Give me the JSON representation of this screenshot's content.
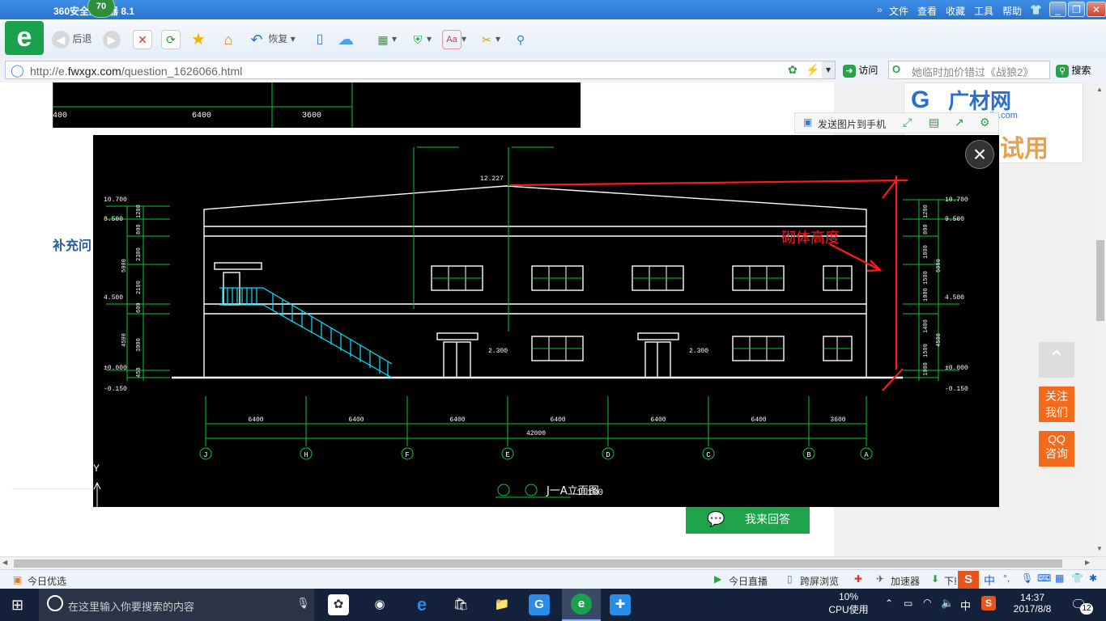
{
  "browser": {
    "title": "360安全浏览器 8.1",
    "badge": "70",
    "menu": [
      "文件",
      "查看",
      "收藏",
      "工具",
      "帮助"
    ],
    "window_buttons": {
      "minimize": "_",
      "maximize": "❐",
      "close": "✕"
    }
  },
  "toolbar": {
    "back_label": "后退",
    "restore_label": "恢复"
  },
  "address_bar": {
    "url_prefix": "http://e.",
    "url_domain": "fwxgx.com",
    "url_path": "/question_1626066.html",
    "visit_label": "访问",
    "search_placeholder": "她临时加价错过《战狼2》",
    "search_label": "搜索"
  },
  "page": {
    "partial_label": "补充问",
    "ad_brand": "广材网",
    "ad_domain": "djc.com",
    "ad_trial": "试用",
    "answer_button": "我来回答",
    "image_toolbar": {
      "send_to_phone": "发送图片到手机"
    },
    "side_buttons": {
      "follow": [
        "关注",
        "我们"
      ],
      "qq": [
        "QQ",
        "咨询"
      ]
    },
    "top_drawing_dims": [
      "400",
      "6400",
      "3600"
    ]
  },
  "drawing": {
    "ridge_elev": "12.227",
    "left_elevs": [
      "10.700",
      "8.500",
      "4.500",
      "±0.000",
      "-0.150"
    ],
    "right_elevs": [
      "10.700",
      "9.500",
      "4.500",
      "±0.000",
      "-0.150"
    ],
    "left_segments": [
      "1200",
      "800",
      "2300",
      "5000",
      "2100",
      "600",
      "4500",
      "3900",
      "450"
    ],
    "right_segments": [
      "1200",
      "800",
      "1800",
      "5000",
      "1500",
      "1000",
      "1400",
      "4500",
      "1500",
      "1000"
    ],
    "bottom_dims": [
      "6400",
      "6400",
      "6400",
      "6400",
      "6400",
      "6400",
      "3600"
    ],
    "total_dim": "42000",
    "axes": [
      "J",
      "H",
      "F",
      "E",
      "D",
      "C",
      "B",
      "A"
    ],
    "canopy_elevs": [
      "2.300",
      "2.300"
    ],
    "annotation": "砌体高度",
    "drawing_title": "J一A立面图",
    "scale": "1:100",
    "ucs_label": "Y"
  },
  "statusbar": {
    "left": "今日优选",
    "items": [
      "今日直播",
      "跨屏浏览",
      "加速器",
      "下载"
    ]
  },
  "taskbar": {
    "search_placeholder": "在这里输入你要搜索的内容",
    "cpu_percent": "10%",
    "cpu_label": "CPU使用",
    "ime": "中",
    "time": "14:37",
    "date": "2017/8/8",
    "notifications": "12"
  },
  "colors": {
    "accent": "#2a73cf",
    "cad_green": "#00cc33",
    "cad_cyan": "#00e5ff",
    "markup_red": "#ff1a1a",
    "side_orange": "#f26a1b"
  }
}
